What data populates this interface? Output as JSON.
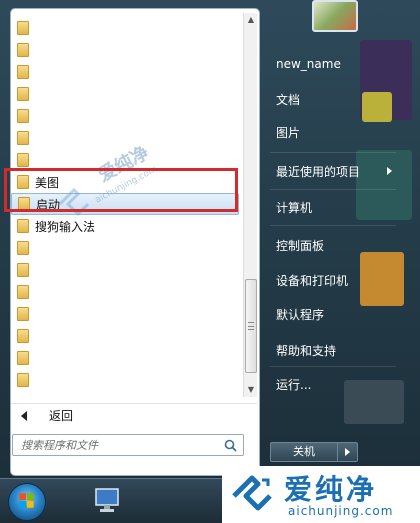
{
  "start_menu": {
    "programs": [
      {
        "label": "",
        "selected": false
      },
      {
        "label": "",
        "selected": false
      },
      {
        "label": "",
        "selected": false
      },
      {
        "label": "",
        "selected": false
      },
      {
        "label": "",
        "selected": false
      },
      {
        "label": "",
        "selected": false
      },
      {
        "label": "",
        "selected": false
      },
      {
        "label": "美图",
        "selected": false
      },
      {
        "label": "启动",
        "selected": true
      },
      {
        "label": "搜狗输入法",
        "selected": false
      },
      {
        "label": "",
        "selected": false
      },
      {
        "label": "",
        "selected": false
      },
      {
        "label": "",
        "selected": false
      },
      {
        "label": "",
        "selected": false
      },
      {
        "label": "",
        "selected": false
      },
      {
        "label": "",
        "selected": false
      },
      {
        "label": "",
        "selected": false
      },
      {
        "label": "══",
        "selected": false
      }
    ],
    "back_label": "返回",
    "search_placeholder": "搜索程序和文件",
    "right_items": [
      {
        "label": "new_name",
        "has_submenu": false
      },
      {
        "label": "文档",
        "has_submenu": false
      },
      {
        "label": "图片",
        "has_submenu": false
      },
      {
        "label": "最近使用的项目",
        "has_submenu": true
      },
      {
        "label": "计算机",
        "has_submenu": false
      },
      {
        "label": "控制面板",
        "has_submenu": false
      },
      {
        "label": "设备和打印机",
        "has_submenu": false
      },
      {
        "label": "默认程序",
        "has_submenu": false
      },
      {
        "label": "帮助和支持",
        "has_submenu": false
      },
      {
        "label": "运行...",
        "has_submenu": false
      }
    ],
    "shutdown_label": "关机"
  },
  "watermark": {
    "cn": "爱纯净",
    "url": "aichunjing.com"
  },
  "brand": {
    "cn": "爱纯净",
    "url": "aichunjing.com"
  },
  "colors": {
    "highlight_border": "#d22b2b",
    "brand_blue": "#1b6fb3",
    "selection_bg": "#c8dff3"
  },
  "icons": {
    "program_icon": "folder-icon",
    "search": "search-icon",
    "back": "back-arrow-icon",
    "start": "windows-start-orb",
    "taskbar_app": "network-computer-icon"
  }
}
